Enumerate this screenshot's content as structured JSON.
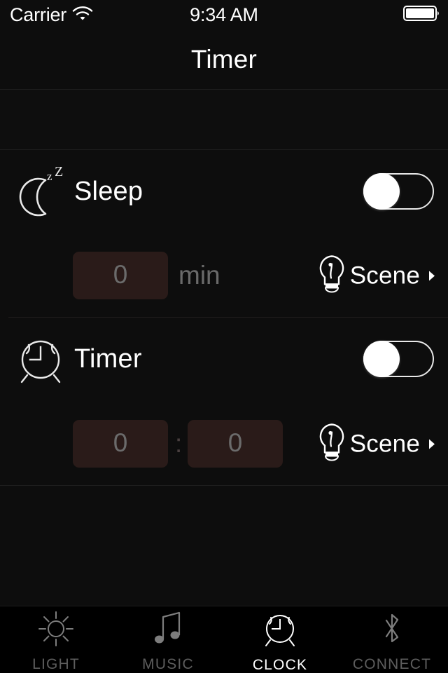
{
  "status_bar": {
    "carrier": "Carrier",
    "wifi_icon": "wifi-icon",
    "time": "9:34 AM",
    "battery_icon": "battery-full-icon"
  },
  "nav": {
    "title": "Timer"
  },
  "sections": {
    "sleep": {
      "icon": "moon-sleep-icon",
      "label": "Sleep",
      "toggle_state": "off",
      "duration_value": "0",
      "duration_unit": "min",
      "scene": {
        "icon": "lightbulb-icon",
        "label": "Scene",
        "chevron": "chevron-right-icon"
      }
    },
    "timer": {
      "icon": "alarm-clock-icon",
      "label": "Timer",
      "toggle_state": "off",
      "hours_value": "0",
      "separator": ":",
      "minutes_value": "0",
      "scene": {
        "icon": "lightbulb-icon",
        "label": "Scene",
        "chevron": "chevron-right-icon"
      }
    }
  },
  "tabbar": {
    "tabs": [
      {
        "label": "LIGHT",
        "icon": "sun-icon",
        "active": false
      },
      {
        "label": "MUSIC",
        "icon": "music-note-icon",
        "active": false
      },
      {
        "label": "CLOCK",
        "icon": "alarm-clock-icon",
        "active": true
      },
      {
        "label": "CONNECT",
        "icon": "bluetooth-icon",
        "active": false
      }
    ]
  },
  "colors": {
    "background": "#0d0d0d",
    "field_background": "#2a1b19",
    "text_primary": "#ffffff",
    "text_muted": "#6a6a6a",
    "tab_inactive": "#5d5d5d",
    "tabbar_background": "#000000"
  }
}
